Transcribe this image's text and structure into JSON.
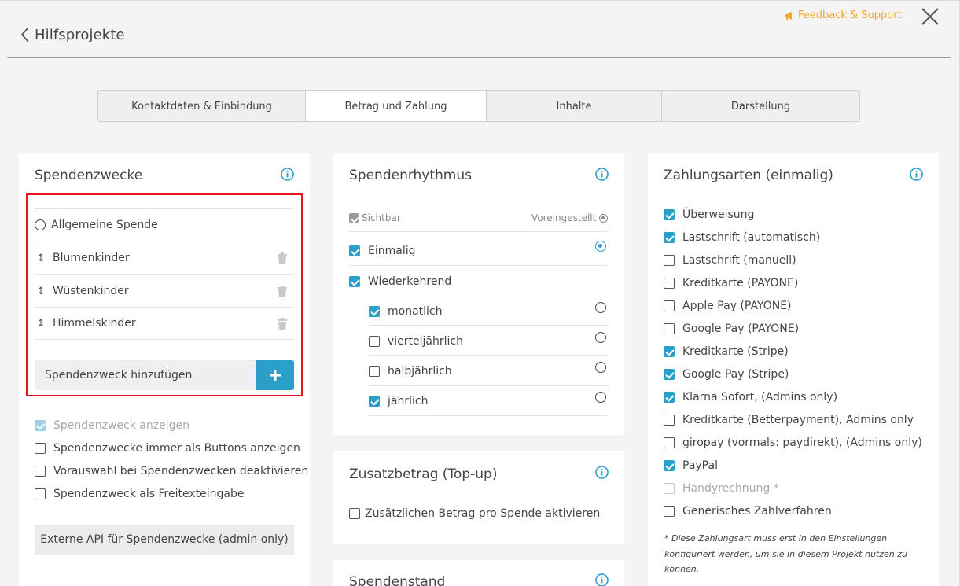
{
  "header": {
    "back_label": "Hilfsprojekte",
    "feedback_label": "Feedback & Support",
    "accent_color": "#f5a623"
  },
  "tabs": [
    {
      "label": "Kontaktdaten & Einbindung",
      "active": false
    },
    {
      "label": "Betrag und Zahlung",
      "active": true
    },
    {
      "label": "Inhalte",
      "active": false
    },
    {
      "label": "Darstellung",
      "active": false
    }
  ],
  "purposes_card": {
    "title": "Spendenzwecke",
    "general": "Allgemeine Spende",
    "items": [
      "Blumenkinder",
      "Wüstenkinder",
      "Himmelskinder"
    ],
    "add_placeholder": "Spendenzweck hinzufügen",
    "options": [
      {
        "label": "Spendenzweck anzeigen",
        "checked": true,
        "disabled": true
      },
      {
        "label": "Spendenzwecke immer als Buttons anzeigen",
        "checked": false,
        "disabled": false
      },
      {
        "label": "Vorauswahl bei Spendenzwecken deaktivieren",
        "checked": false,
        "disabled": false
      },
      {
        "label": "Spendenzweck als Freitexteingabe",
        "checked": false,
        "disabled": false
      }
    ],
    "api_button": "Externe API für Spendenzwecke (admin only)"
  },
  "rhythm_card": {
    "title": "Spendenrhythmus",
    "col_visible": "Sichtbar",
    "col_default": "Voreingestellt",
    "rows": [
      {
        "label": "Einmalig",
        "checked": true,
        "default": true
      },
      {
        "label": "Wiederkehrend",
        "checked": true
      },
      {
        "label": "monatlich",
        "checked": true,
        "default": false
      },
      {
        "label": "vierteljährlich",
        "checked": false,
        "default": false
      },
      {
        "label": "halbjährlich",
        "checked": false,
        "default": false
      },
      {
        "label": "jährlich",
        "checked": true,
        "default": false
      }
    ]
  },
  "topup_card": {
    "title": "Zusatzbetrag (Top-up)",
    "option": "Zusätzlichen Betrag pro Spende aktivieren"
  },
  "status_card": {
    "title": "Spendenstand"
  },
  "payment_card": {
    "title": "Zahlungsarten (einmalig)",
    "methods": [
      {
        "label": "Überweisung",
        "checked": true
      },
      {
        "label": "Lastschrift (automatisch)",
        "checked": true
      },
      {
        "label": "Lastschrift (manuell)",
        "checked": false
      },
      {
        "label": "Kreditkarte (PAYONE)",
        "checked": false
      },
      {
        "label": "Apple Pay (PAYONE)",
        "checked": false
      },
      {
        "label": "Google Pay (PAYONE)",
        "checked": false
      },
      {
        "label": "Kreditkarte (Stripe)",
        "checked": true
      },
      {
        "label": "Google Pay (Stripe)",
        "checked": true
      },
      {
        "label": "Klarna Sofort, (Admins only)",
        "checked": true
      },
      {
        "label": "Kreditkarte (Betterpayment), Admins only",
        "checked": false
      },
      {
        "label": "giropay (vormals: paydirekt), (Admins only)",
        "checked": false
      },
      {
        "label": "PayPal",
        "checked": true
      },
      {
        "label": "Handyrechnung *",
        "checked": false,
        "disabled": true
      },
      {
        "label": "Generisches Zahlverfahren",
        "checked": false
      }
    ],
    "note": "* Diese Zahlungsart muss erst in den Einstellungen konfiguriert werden, um sie in diesem Projekt nutzen zu können."
  },
  "colors": {
    "primary": "#2a9fc9",
    "highlight_box": "#e8141c"
  }
}
